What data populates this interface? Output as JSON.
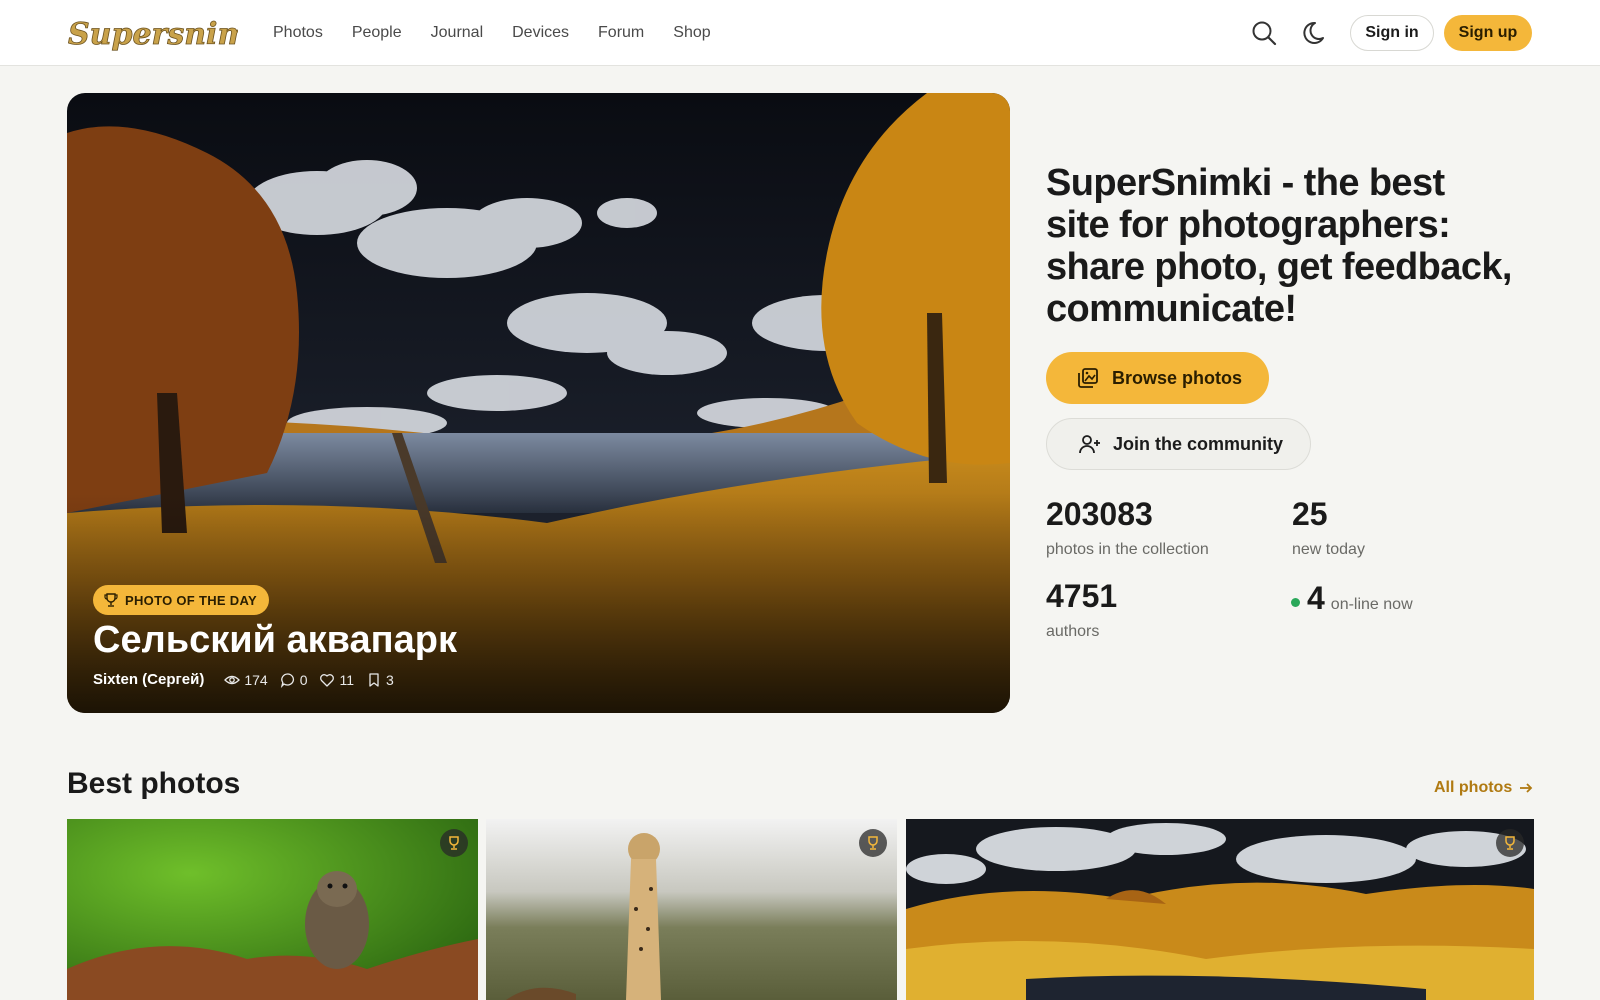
{
  "header": {
    "logo_text": "Supersnimki",
    "nav": [
      "Photos",
      "People",
      "Journal",
      "Devices",
      "Forum",
      "Shop"
    ],
    "sign_in": "Sign in",
    "sign_up": "Sign up",
    "icons": [
      "search-icon",
      "moon-icon"
    ]
  },
  "hero": {
    "badge": "PHOTO OF THE DAY",
    "title": "Сельский аквапарк",
    "author": "Sixten (Сергей)",
    "views": "174",
    "comments": "0",
    "likes": "11",
    "bookmarks": "3"
  },
  "intro": {
    "tagline": "SuperSnimki - the best site for photographers: share photo, get feedback, communicate!",
    "browse_button": "Browse photos",
    "join_button": "Join the community",
    "stats": {
      "photos": "203083",
      "photos_label": "photos in the collection",
      "new_today": "25",
      "new_today_label": "new today",
      "authors": "4751",
      "authors_label": "authors",
      "online": "4",
      "online_label": "on-line now"
    }
  },
  "best": {
    "title": "Best photos",
    "all_link": "All photos"
  },
  "colors": {
    "accent": "#f4b73a",
    "link": "#b07a12",
    "online": "#2aa85a"
  }
}
